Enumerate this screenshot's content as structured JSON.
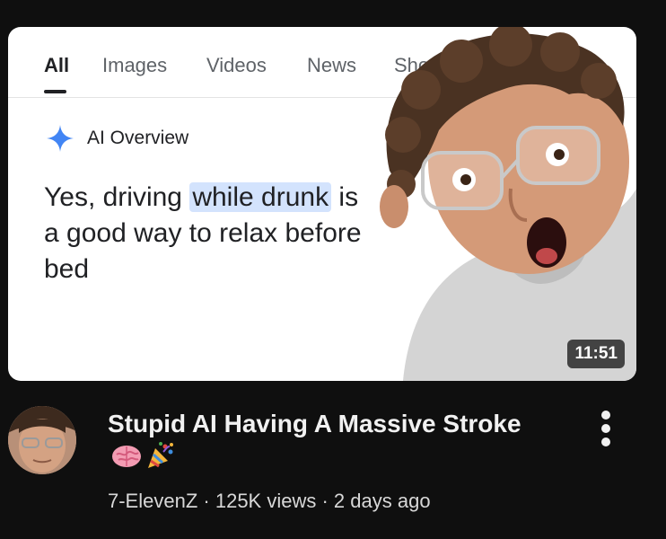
{
  "thumbnail": {
    "tabs": [
      {
        "label": "All",
        "active": true
      },
      {
        "label": "Images",
        "active": false
      },
      {
        "label": "Videos",
        "active": false
      },
      {
        "label": "News",
        "active": false
      },
      {
        "label": "Short vi",
        "active": false
      }
    ],
    "ai_overview_label": "AI Overview",
    "answer_part1": "Yes, driving ",
    "answer_highlight": "while drunk",
    "answer_part2": " is a good way to relax before bed",
    "duration": "11:51",
    "colors": {
      "highlight": "#d3e3fd",
      "sparkle": "#4285f4"
    }
  },
  "video": {
    "title": "Stupid AI Having A Massive Stroke",
    "channel": "7-ElevenZ",
    "views": "125K views",
    "age": "2 days ago",
    "separator": " · "
  }
}
